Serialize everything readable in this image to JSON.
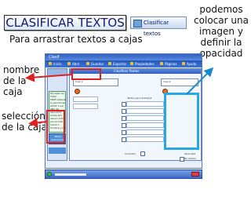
{
  "header": {
    "title": "CLASIFICAR TEXTOS",
    "button_label": "Clasificar textos",
    "subtitle": "Para arrastrar textos a cajas"
  },
  "annotations": {
    "right": "podemos colocar una imagen y definir la opacidad",
    "box_name": "nombre de la caja",
    "selection": "selección de la caja"
  },
  "app": {
    "window_title": "Clasif",
    "toolbar": [
      "Inicio",
      "Abrir",
      "Guardar",
      "Exportar",
      "Propiedades",
      "Páginas",
      "Ayuda"
    ],
    "main_title": "Clasificar Textos",
    "box_a_label": "Caja 1",
    "box_b_label": "Caja 2",
    "left_items": [
      "MJ cajas ver",
      "TLEQ",
      "MINF Obtener",
      "A_periódicas",
      "ACCIF 2 ver",
      "ABC 4A",
      "abonoFAF",
      "arriba Jacl",
      "sensor Adminis",
      "Jos sol 110",
      "Carne 1",
      "hombre y DOCC"
    ],
    "left_buttons": [
      "Textos",
      "Seleccionar",
      "Textos"
    ],
    "mid_label": "Textos para distribuir",
    "quantity_label": "Cantidad",
    "opacity_label": "Opacidad",
    "check_label": "No dentro"
  },
  "colors": {
    "accent_red": "#e02020",
    "accent_blue": "#2aa8e6",
    "toolbar_blue": "#2458b8"
  }
}
